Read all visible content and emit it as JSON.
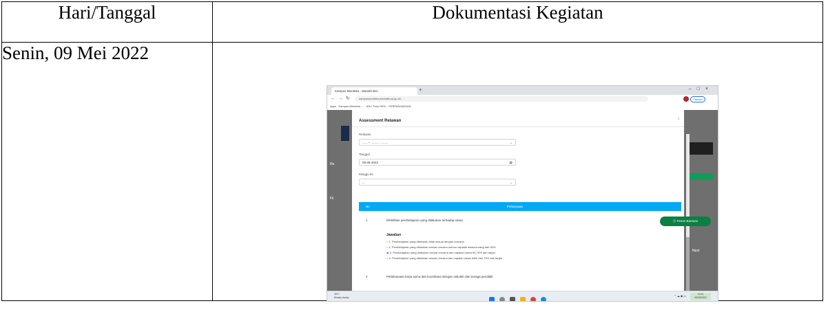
{
  "table": {
    "headers": [
      "Hari/Tanggal",
      "Dokumentasi Kegiatan"
    ],
    "rows": [
      {
        "date": "Senin, 09 Mei 2022"
      }
    ]
  },
  "screenshot": {
    "browser": {
      "tab_title": "Kampus Merdeka - Mandiri Bel...",
      "url": "kampusmerdeka.kemdikbud.go.id/...",
      "profile_label": "Paused",
      "bookmarks": [
        "Apps",
        "Kampus Merdeka -...",
        "ADV Tutor HEN.",
        "PERPANJANGAN"
      ]
    },
    "modal": {
      "title": "Assessment Relawan",
      "fields": [
        {
          "label": "Relawan",
          "value": "...... – .......... ........",
          "icon": "chevron-down-icon"
        },
        {
          "label": "Tanggal",
          "value": "09-05-2022",
          "icon": "calendar-icon"
        },
        {
          "label": "Minggu ke",
          "value": "...",
          "icon": "chevron-down-icon"
        }
      ],
      "table_headers": [
        "No",
        "Pertanyaan"
      ],
      "questions": [
        {
          "no": "1",
          "text": "Efektifitas pembelajaran yang dilakukan terhadap siswa"
        },
        {
          "no": "2",
          "text": "Pelaksanaan kerja sama dan koordinasi dengan sekolah dan tenaga pendidik"
        }
      ],
      "answer_label": "Jawaban",
      "options": [
        "1. Pembelajaran yang dilakukan tidak sesuai dengan rencana",
        "2. Pembelajaran yang dilakukan sesuai rencana namun capaian siswa kurang dari 50%",
        "3. Pembelajaran yang dilakukan sesuai rencana dan capaian siswa 50-75% dari target",
        "4. Pembelajaran yang dilakukan sesuai rencana dan capaian siswa lebih dari 75% dari target"
      ],
      "selected_option": 2
    },
    "side": {
      "button": "Pesan Bantuan",
      "left_labels": [
        "Re",
        "Fil"
      ],
      "right_label": "Next"
    },
    "taskbar": {
      "weather_temp": "26°C",
      "weather_desc": "Mostly cloudy",
      "time": "10:11",
      "date": "09/05/2022"
    }
  }
}
